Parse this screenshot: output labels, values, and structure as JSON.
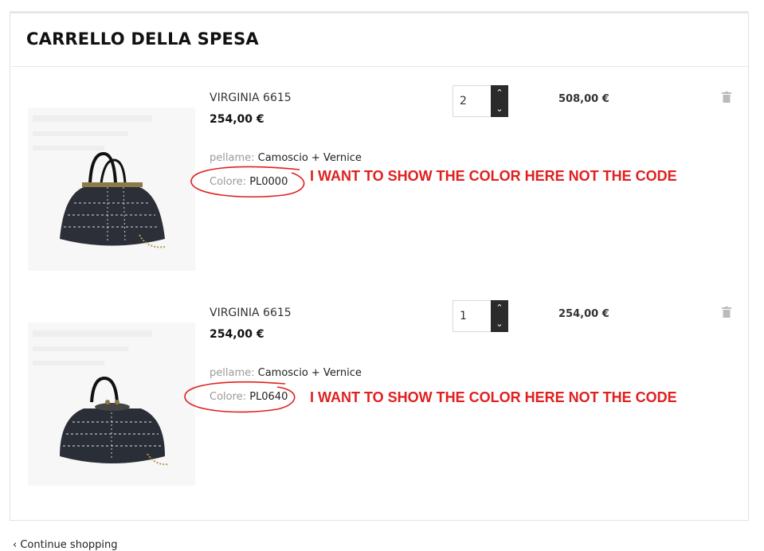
{
  "cart": {
    "title": "CARRELLO DELLA SPESA"
  },
  "items": [
    {
      "name": "VIRGINIA 6615",
      "price": "254,00 €",
      "quantity": "2",
      "line_total": "508,00 €",
      "attrs": [
        {
          "label": "pellame:",
          "value": "Camoscio + Vernice"
        },
        {
          "label": "Colore:",
          "value": "PL0000"
        }
      ],
      "annotation": "I WANT TO SHOW THE COLOR HERE NOT THE CODE"
    },
    {
      "name": "VIRGINIA 6615",
      "price": "254,00 €",
      "quantity": "1",
      "line_total": "254,00 €",
      "attrs": [
        {
          "label": "pellame:",
          "value": "Camoscio + Vernice"
        },
        {
          "label": "Colore:",
          "value": "PL0640"
        }
      ],
      "annotation": "I WANT TO SHOW THE COLOR HERE NOT THE CODE"
    }
  ],
  "footer": {
    "continue_label": "Continue shopping"
  },
  "colors": {
    "annotation": "#e02020",
    "qty_buttons": "#2b2b2b"
  }
}
